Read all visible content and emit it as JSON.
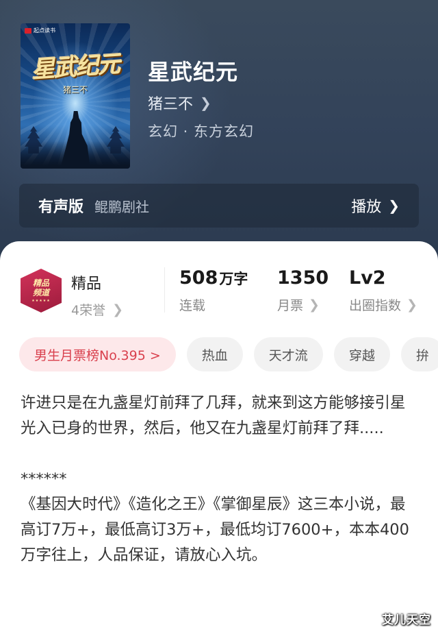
{
  "book": {
    "cover_publisher": "起点读书",
    "cover_title": "星武纪元",
    "cover_author": "猪三不",
    "title": "星武纪元",
    "author": "猪三不",
    "genre": "玄幻 · 东方玄幻"
  },
  "audio": {
    "label": "有声版",
    "studio": "鲲鹏剧社",
    "play_label": "播放"
  },
  "badge": {
    "line1": "精品",
    "line2": "频道",
    "stars": "★★★★★"
  },
  "stats": {
    "quality_title": "精品",
    "quality_sub": "4荣誉",
    "words_value": "508",
    "words_unit": "万字",
    "words_label": "连载",
    "tickets_value": "1350",
    "tickets_label": "月票",
    "level_value": "Lv2",
    "level_label": "出圈指数"
  },
  "tags": {
    "rank": "男生月票榜No.395 >",
    "t1": "热血",
    "t2": "天才流",
    "t3": "穿越",
    "t4": "拚"
  },
  "description": {
    "para1": "许进只是在九盏星灯前拜了几拜，就来到这方能够接引星光入已身的世界，然后，他又在九盏星灯前拜了拜.....",
    "separator": "******",
    "para2": "《基因大时代》《造化之王》《掌御星辰》这三本小说，最高订7万+，最低高订3万+，最低均订7600+，本本400万字往上，人品保证，请放心入坑。"
  },
  "watermark": "艾儿天空",
  "colors": {
    "header_bg": "#33435a",
    "rank_tag_bg": "#fde8ea",
    "rank_tag_text": "#d9404d",
    "tag_bg": "#f2f2f2",
    "badge": "#b8264a"
  },
  "icons": {
    "chevron": "chevron-right-icon"
  }
}
